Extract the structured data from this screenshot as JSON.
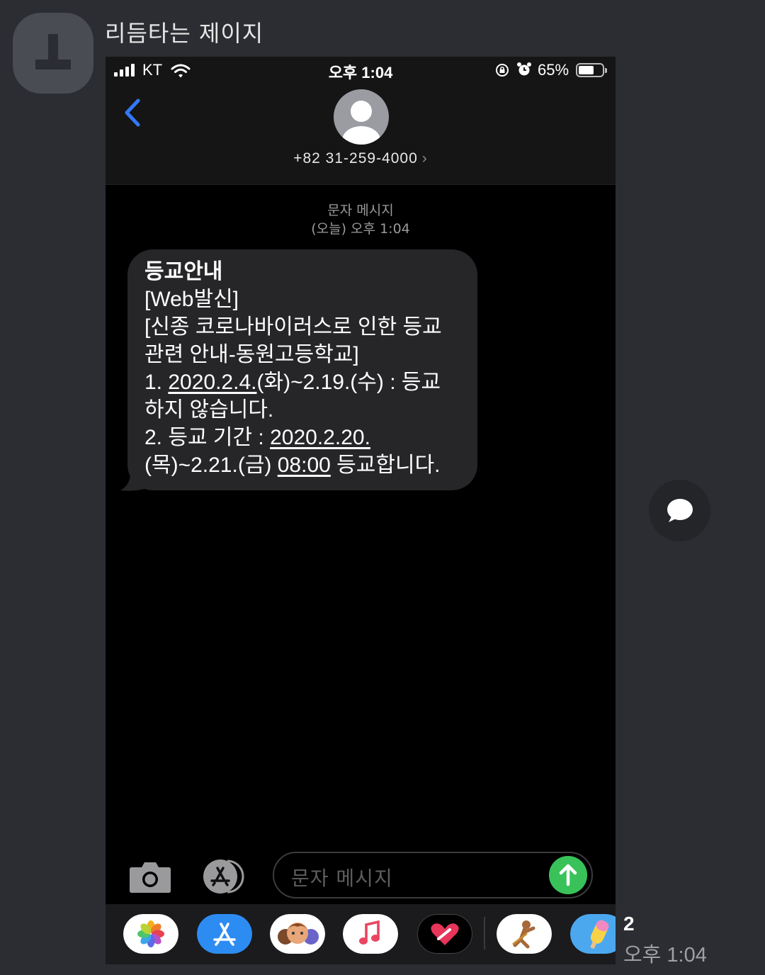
{
  "chat": {
    "sender_name": "리듬타는 제이지",
    "unread_count": "2",
    "time": "오후 1:04"
  },
  "screenshot": {
    "status_bar": {
      "carrier": "KT",
      "time": "오후 1:04",
      "battery": "65%",
      "battery_level": 0.65
    },
    "contact": {
      "phone": "+82 31-259-4000",
      "chevron": "›"
    },
    "thread_meta": {
      "type": "문자 메시지",
      "timestamp": "(오늘) 오후 1:04"
    },
    "message": {
      "title": "등교안내",
      "l2": "[Web발신]",
      "l3": "[신종 코로나바이러스로 인한 등교",
      "l4": "관련 안내-동원고등학교]",
      "l5_pre": "1. ",
      "l5_link": "2020.2.4.",
      "l5_post": "(화)~2.19.(수) : 등교",
      "l6": "하지 않습니다.",
      "l7_pre": "2. 등교 기간 : ",
      "l7_link": "2020.2.20.",
      "l8_pre": "(목)~2.21.(금) ",
      "l8_link": "08:00",
      "l8_post": " 등교합니다."
    },
    "composer": {
      "placeholder": "문자 메시지"
    },
    "app_drawer": [
      "photos-app",
      "app-store-app",
      "memoji-app",
      "music-app",
      "digital-touch-app",
      "sticker-app",
      "popsicle-sticker-app"
    ]
  },
  "colors": {
    "background": "#2b2d33",
    "bubble": "#262628",
    "accent_blue": "#3478f6",
    "send_green": "#39c25a"
  }
}
